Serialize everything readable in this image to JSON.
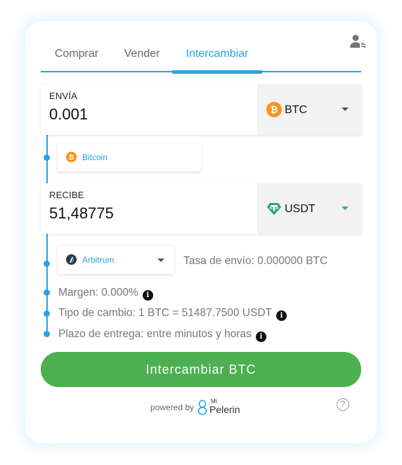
{
  "tabs": [
    {
      "label": "Comprar"
    },
    {
      "label": "Vender"
    },
    {
      "label": "Intercambiar"
    }
  ],
  "send": {
    "label": "ENVÍA",
    "value": "0.001",
    "coin": "BTC",
    "network": "Bitcoin"
  },
  "receive": {
    "label": "RECIBE",
    "value": "51,48775",
    "coin": "USDT",
    "network": "Arbitrum"
  },
  "fee": "Tasa de envío: 0.000000 BTC",
  "info": {
    "margin": "Margen: 0.000%",
    "rate": "Tipo de cambio: 1 BTC = 51487.7500 USDT",
    "delivery": "Plazo de entrega: entre minutos y horas",
    "icon_glyph": "i"
  },
  "cta_label": "Intercambiar BTC",
  "footer": {
    "powered_by": "powered by",
    "brand_sup": "Mt",
    "brand_name": "Pelerin",
    "help_glyph": "?"
  },
  "colors": {
    "accent": "#28a3e0",
    "cta": "#4caf50",
    "btc": "#f7931a",
    "usdt": "#26a17b"
  },
  "icons": {
    "user": "user-switch-icon",
    "btc": "bitcoin-icon",
    "usdt": "tether-icon",
    "arbitrum": "arbitrum-icon",
    "info": "info-icon",
    "help": "help-icon"
  }
}
